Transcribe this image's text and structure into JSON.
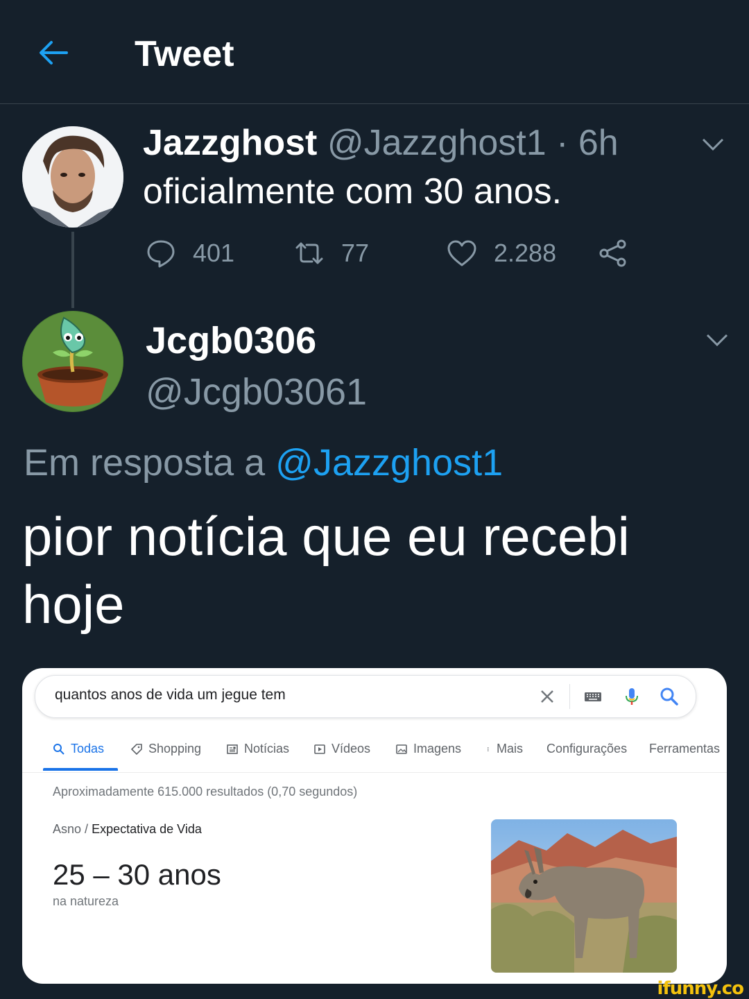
{
  "header": {
    "title": "Tweet"
  },
  "tweet1": {
    "name": "Jazzghost",
    "handle_time": "@Jazzghost1 · 6h",
    "text": "oficialmente com 30 anos.",
    "replies": "401",
    "retweets": "77",
    "likes": "2.288"
  },
  "tweet2": {
    "name": "Jcgb0306",
    "handle": "@Jcgb03061",
    "reply_prefix": "Em resposta a",
    "reply_to": "@Jazzghost1",
    "text": "pior notícia que eu recebi hoje"
  },
  "google": {
    "query": "quantos anos de vida um jegue tem",
    "tabs": [
      "Todas",
      "Shopping",
      "Notícias",
      "Vídeos",
      "Imagens",
      "Mais",
      "Configurações",
      "Ferramentas"
    ],
    "stats": "Aproximadamente 615.000 resultados (0,70 segundos)",
    "breadcrumb_root": "Asno",
    "breadcrumb_sep": "/",
    "breadcrumb_current": "Expectativa de Vida",
    "answer": "25 – 30 anos",
    "answer_sub": "na natureza"
  },
  "watermark": "ifunny.co",
  "colors": {
    "background": "#15202b",
    "accent": "#1da1f2",
    "muted": "#8899a6",
    "google_blue": "#1a73e8"
  }
}
